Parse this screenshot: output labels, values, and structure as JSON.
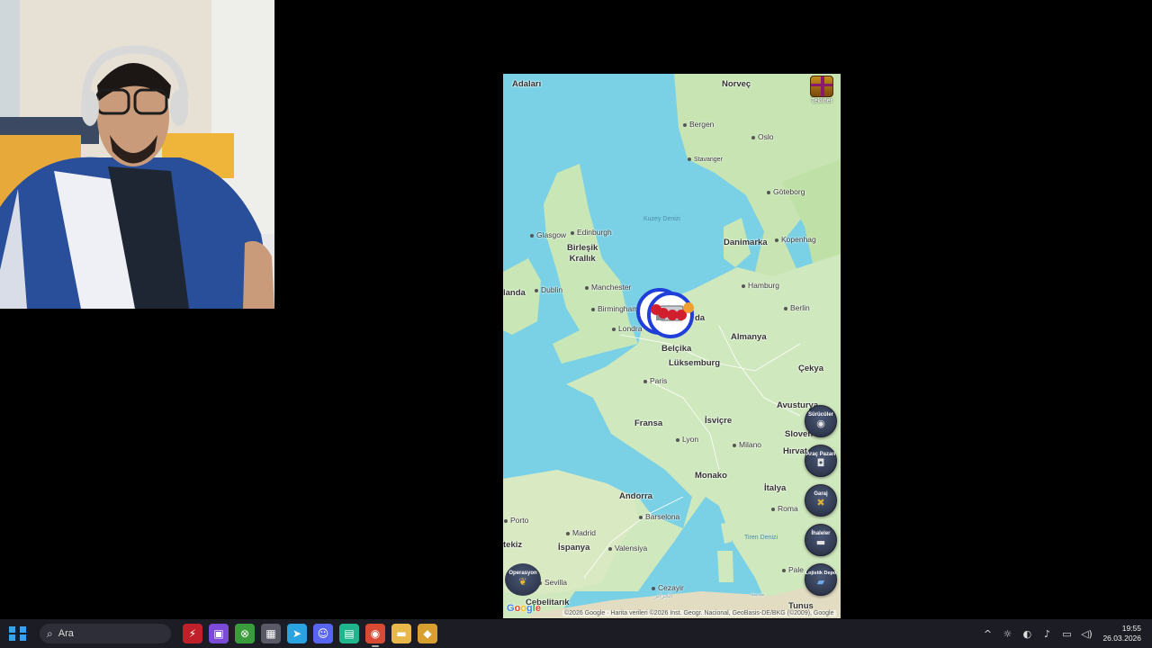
{
  "map": {
    "countries": {
      "norvec": "Norveç",
      "birlesik_krallik": "Birleşik\nKrallık",
      "danimarka": "Danimarka",
      "almanya": "Almanya",
      "belcika": "Belçika",
      "luksemburg": "Lüksemburg",
      "cekya": "Çekya",
      "fransa": "Fransa",
      "isvicre": "İsviçre",
      "avusturya": "Avusturya",
      "slovenya": "Sloven",
      "hirvatistan": "Hırvat",
      "monako": "Monako",
      "italya": "İtalya",
      "andorra": "Andorra",
      "ispanya": "İspanya",
      "cebelitarik": "Cebelitarık",
      "irlanda": "landa",
      "hollanda": "da",
      "faroe": "Adaları",
      "portekiz": "tekiz"
    },
    "cities": {
      "bergen": "Bergen",
      "oslo": "Oslo",
      "stavanger": "Stavanger",
      "goteborg": "Göteborg",
      "edinburgh": "Edinburgh",
      "glasgow": "Glasgow",
      "kopenhag": "Kopenhag",
      "dublin": "Dublin",
      "manchester": "Manchester",
      "hamburg": "Hamburg",
      "birmingham": "Birmingham",
      "berlin": "Berlin",
      "londra": "Londra",
      "paris": "Paris",
      "lyon": "Lyon",
      "milano": "Milano",
      "barselona": "Barselona",
      "porto": "Porto",
      "madrid": "Madrid",
      "valensiya": "Valensiya",
      "roma": "Roma",
      "sevilla": "Sevilla",
      "cezayir": "Cezayir",
      "cezayir_ar": "الجزائر",
      "tunus_ar": "مدينة",
      "palermo": "Pale",
      "tunus": "Tunus"
    },
    "seas": {
      "kuzey_denizi": "Kuzey Denizi",
      "tiren_denizi": "Tiren Denizi"
    },
    "google_logo": "Google",
    "attribution": "©2026 Google · Harita verileri ©2026 Inst. Geogr. Nacional, GeoBasis-DE/BKG (©2009), Google"
  },
  "buttons": {
    "offers": "Teklifler",
    "drivers": "Sürücüler",
    "vehicle_market": "Araç Pazarı",
    "garage": "Garaj",
    "tenders": "İhaleler",
    "logistics_depot": "Lojistik Depo",
    "operations": "Operasyon"
  },
  "icons": {
    "drivers": "steering-wheel-icon",
    "vehicle_market": "camera-icon",
    "garage": "wrench-icon",
    "tenders": "truck-icon",
    "logistics_depot": "book-icon",
    "operations": "wings-icon"
  },
  "taskbar": {
    "search_placeholder": "Ara",
    "apps": [
      {
        "name": "app-red",
        "glyph": "⚡",
        "color": "#c0202a"
      },
      {
        "name": "twitch",
        "glyph": "▣",
        "color": "#7b4ad8"
      },
      {
        "name": "xbox",
        "glyph": "⊗",
        "color": "#3a9c3a"
      },
      {
        "name": "calculator",
        "glyph": "▦",
        "color": "#5a5a66"
      },
      {
        "name": "telegram",
        "glyph": "➤",
        "color": "#2aa3e0"
      },
      {
        "name": "discord",
        "glyph": "☺",
        "color": "#5865f2"
      },
      {
        "name": "chat-app",
        "glyph": "▤",
        "color": "#1fb68e"
      },
      {
        "name": "chrome",
        "glyph": "◉",
        "color": "#d84a34"
      },
      {
        "name": "file-explorer",
        "glyph": "▬",
        "color": "#e8b84a"
      },
      {
        "name": "game-app",
        "glyph": "◆",
        "color": "#d8a030"
      }
    ],
    "time": "19:55",
    "date": "26.03.2026"
  },
  "colors": {
    "sea": "#7ad1e6",
    "land": "#c9e6b7",
    "marker_blue": "#1f3fd8",
    "marker_red": "#d11f2e",
    "accent": "#3aa0f0"
  }
}
